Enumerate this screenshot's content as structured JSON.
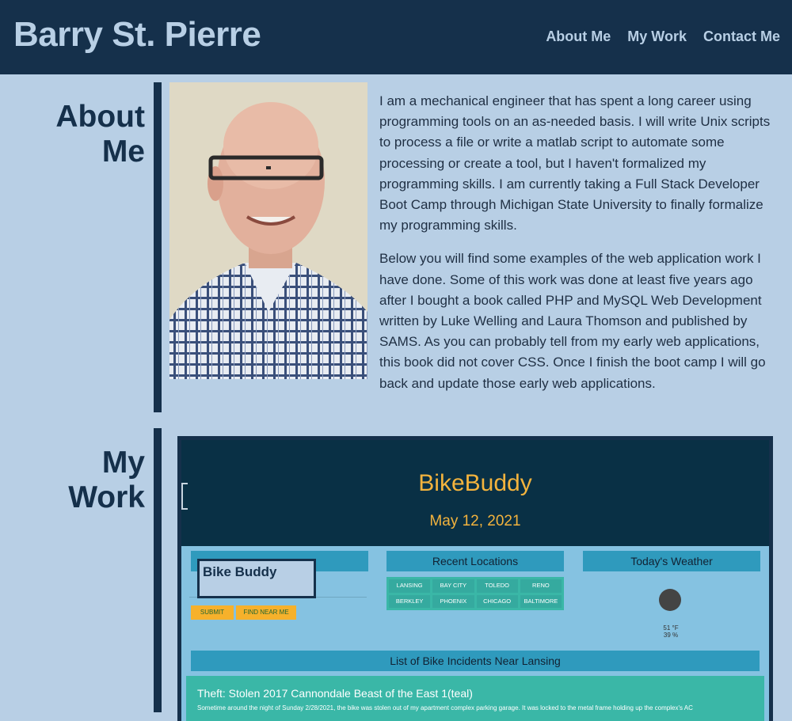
{
  "header": {
    "brand": "Barry St. Pierre",
    "nav": [
      "About Me",
      "My Work",
      "Contact Me"
    ]
  },
  "about": {
    "title_line1": "About",
    "title_line2": "Me",
    "paragraphs": [
      "I am a mechanical engineer that has spent a long career using programming tools on an as-needed basis. I will write Unix scripts to process a file or write a matlab script to automate some processing or create a tool, but I haven't formalized my programming skills. I am currently taking a Full Stack Developer Boot Camp through Michigan State University to finally formalize my programming skills.",
      "Below you will find some examples of the web application work I have done. Some of this work was done at least five years ago after I bought a book called PHP and MySQL Web Development written by Luke Welling and Laura Thomson and published by SAMS. As you can probably tell from my early web applications, this book did not cover CSS. Once I finish the boot camp I will go back and update those early web applications."
    ]
  },
  "work": {
    "title_line1": "My",
    "title_line2": "Work",
    "project_caption": "Bike Buddy",
    "screenshot": {
      "app_title": "BikeBuddy",
      "date": "May 12, 2021",
      "panels": [
        "Recent Locations",
        "Today's Weather"
      ],
      "cities": [
        "LANSING",
        "BAY CITY",
        "TOLEDO",
        "RENO",
        "BERKLEY",
        "PHOENIX",
        "CHICAGO",
        "BALTIMORE"
      ],
      "buttons": [
        "SUBMIT",
        "FIND NEAR ME"
      ],
      "weather_temp": "51 °F",
      "weather_humidity": "39 %",
      "list_title": "List of Bike Incidents Near Lansing",
      "incident_title": "Theft: Stolen 2017 Cannondale Beast of the East 1(teal)",
      "incident_text": "Sometime around the night of Sunday 2/28/2021, the bike was stolen out of my apartment complex parking garage. It was locked to the metal frame holding up the complex's AC"
    }
  }
}
